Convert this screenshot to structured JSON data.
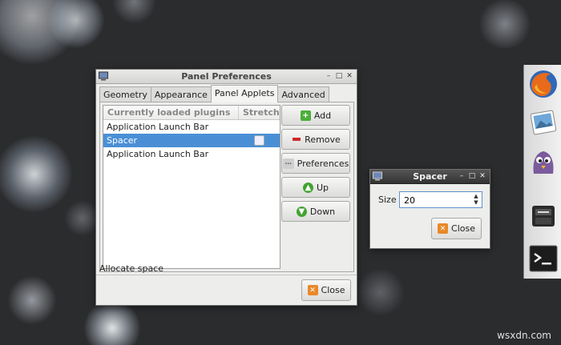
{
  "panel_prefs": {
    "title": "Panel Preferences",
    "tabs": [
      {
        "label": "Geometry",
        "active": false
      },
      {
        "label": "Appearance",
        "active": false
      },
      {
        "label": "Panel Applets",
        "active": true
      },
      {
        "label": "Advanced",
        "active": false
      }
    ],
    "list": {
      "header_name": "Currently loaded plugins",
      "header_stretch": "Stretch",
      "rows": [
        {
          "name": "Application Launch Bar",
          "selected": false
        },
        {
          "name": "Spacer",
          "selected": true
        },
        {
          "name": "Application Launch Bar",
          "selected": false
        }
      ]
    },
    "buttons": {
      "add": "Add",
      "remove": "Remove",
      "preferences": "Preferences",
      "up": "Up",
      "down": "Down"
    },
    "status": "Allocate space",
    "close": "Close"
  },
  "spacer_dialog": {
    "title": "Spacer",
    "size_label": "Size",
    "size_value": "20",
    "close": "Close"
  },
  "watermark": "wsxdn.com",
  "dock": {
    "icons": [
      "firefox-icon",
      "image-viewer-icon",
      "pidgin-icon",
      "file-manager-icon",
      "terminal-icon"
    ]
  }
}
